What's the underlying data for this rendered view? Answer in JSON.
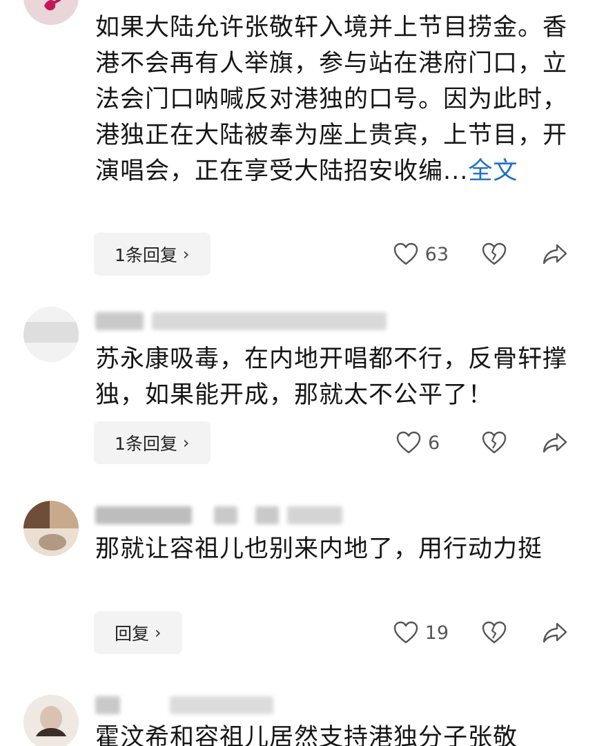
{
  "comments": [
    {
      "text": "如果大陆允许张敬轩入境并上节目捞金。香港不会再有人举旗，参与站在港府门口，立法会门口呐喊反对港独的口号。因为此时，港独正在大陆被奉为座上贵宾，上节目，开演唱会，正在享受大陆招安收编",
      "ellipsis": "...",
      "more_label": "全文",
      "reply_label": "1条回复",
      "likes": "63"
    },
    {
      "text": "苏永康吸毒，在内地开唱都不行，反骨轩撑独，如果能开成，那就太不公平了！",
      "reply_label": "1条回复",
      "likes": "6"
    },
    {
      "text": "那就让容祖儿也别来内地了，用行动力挺",
      "reply_label": "回复",
      "likes": "19"
    },
    {
      "text": "霍汶希和容祖儿居然支持港独分子张敬"
    }
  ],
  "icons": {
    "like": "heart-outline-icon",
    "dislike": "broken-heart-icon",
    "share": "share-arrow-icon",
    "chevron": "chevron-right-icon"
  },
  "colors": {
    "link": "#1e6fc1",
    "reply_bg": "#f3f3f3",
    "text": "#161616"
  }
}
